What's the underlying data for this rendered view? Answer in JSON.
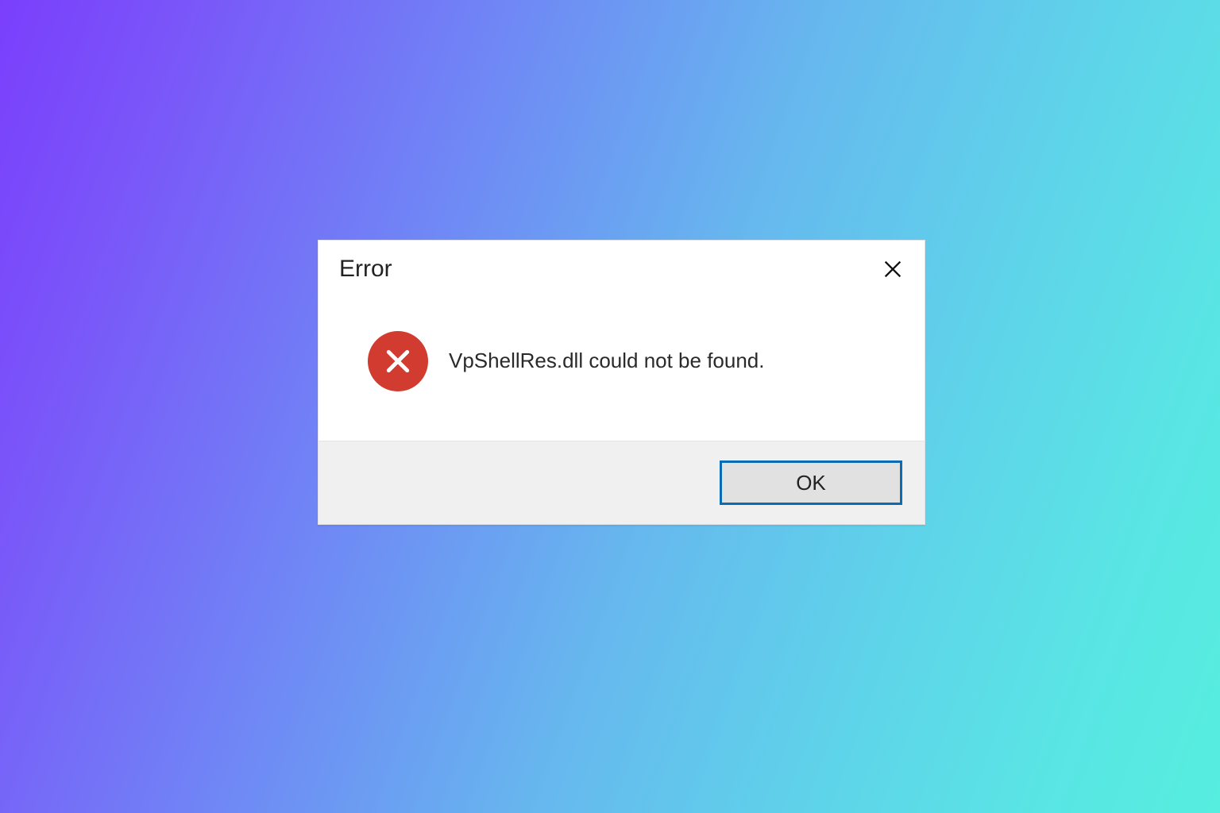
{
  "dialog": {
    "title": "Error",
    "message": "VpShellRes.dll could not be found.",
    "ok_label": "OK"
  }
}
